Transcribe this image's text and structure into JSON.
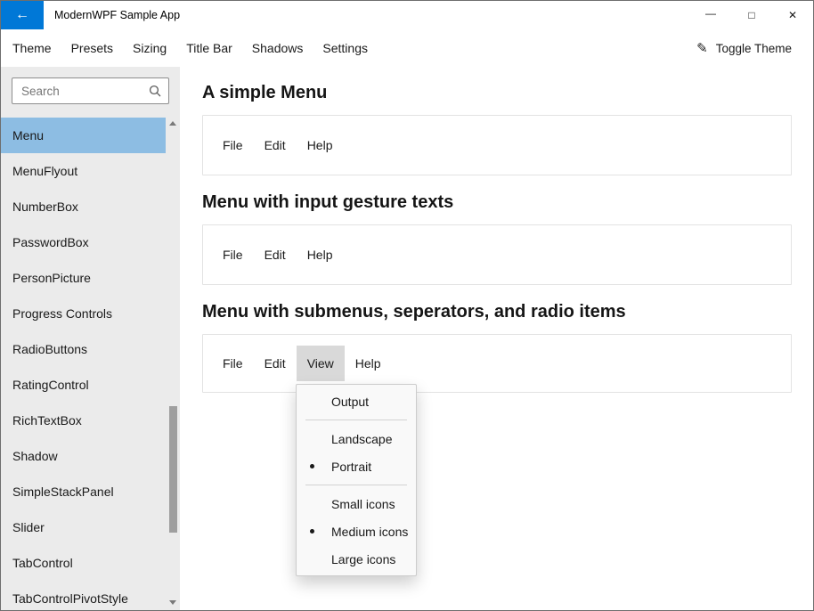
{
  "window": {
    "title": "ModernWPF Sample App",
    "back_icon": "←",
    "minimize_icon": "—",
    "maximize_icon": "□",
    "close_icon": "✕"
  },
  "menubar": {
    "items": [
      "Theme",
      "Presets",
      "Sizing",
      "Title Bar",
      "Shadows",
      "Settings"
    ],
    "toggle_theme_icon": "✎",
    "toggle_theme_label": "Toggle Theme"
  },
  "sidebar": {
    "search_placeholder": "Search",
    "selected_item": "Menu",
    "items": [
      "Menu",
      "MenuFlyout",
      "NumberBox",
      "PasswordBox",
      "PersonPicture",
      "Progress Controls",
      "RadioButtons",
      "RatingControl",
      "RichTextBox",
      "Shadow",
      "SimpleStackPanel",
      "Slider",
      "TabControl",
      "TabControlPivotStyle"
    ]
  },
  "main": {
    "sections": [
      {
        "title": "A simple Menu",
        "menu": [
          "File",
          "Edit",
          "Help"
        ]
      },
      {
        "title": "Menu with input gesture texts",
        "menu": [
          "File",
          "Edit",
          "Help"
        ]
      },
      {
        "title": "Menu with submenus, seperators, and radio items",
        "menu": [
          "File",
          "Edit",
          "View",
          "Help"
        ],
        "open_menu": "View"
      }
    ],
    "view_dropdown": {
      "items": [
        {
          "label": "Output",
          "selected": false
        },
        {
          "label": "Landscape",
          "selected": false
        },
        {
          "label": "Portrait",
          "selected": true
        },
        {
          "label": "Small icons",
          "selected": false
        },
        {
          "label": "Medium icons",
          "selected": true
        },
        {
          "label": "Large icons",
          "selected": false
        }
      ]
    }
  },
  "colors": {
    "accent": "#0078d7",
    "selection": "#8dbde3"
  }
}
